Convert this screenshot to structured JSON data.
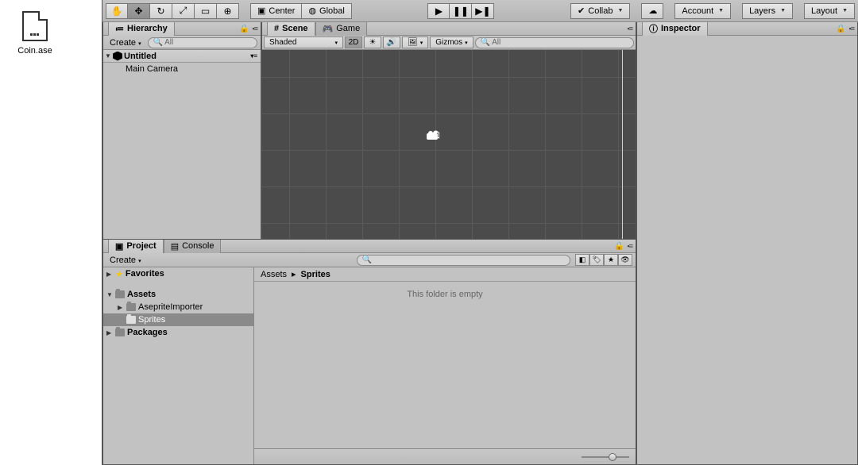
{
  "desktop": {
    "file_name": "Coin.ase"
  },
  "toolbar": {
    "pivot": "Center",
    "space": "Global",
    "collab": "Collab",
    "account": "Account",
    "layers": "Layers",
    "layout": "Layout"
  },
  "hierarchy": {
    "title": "Hierarchy",
    "create": "Create",
    "search_placeholder": "All",
    "scene": "Untitled",
    "items": [
      "Main Camera"
    ]
  },
  "scene": {
    "tab_scene": "Scene",
    "tab_game": "Game",
    "draw_mode": "Shaded",
    "mode2d": "2D",
    "gizmos": "Gizmos",
    "search_placeholder": "All"
  },
  "project": {
    "tab_project": "Project",
    "tab_console": "Console",
    "create": "Create",
    "favorites": "Favorites",
    "assets": "Assets",
    "folders": [
      "AsepriteImporter",
      "Sprites"
    ],
    "packages": "Packages",
    "breadcrumb_root": "Assets",
    "breadcrumb_current": "Sprites",
    "empty_text": "This folder is empty"
  },
  "inspector": {
    "title": "Inspector"
  }
}
